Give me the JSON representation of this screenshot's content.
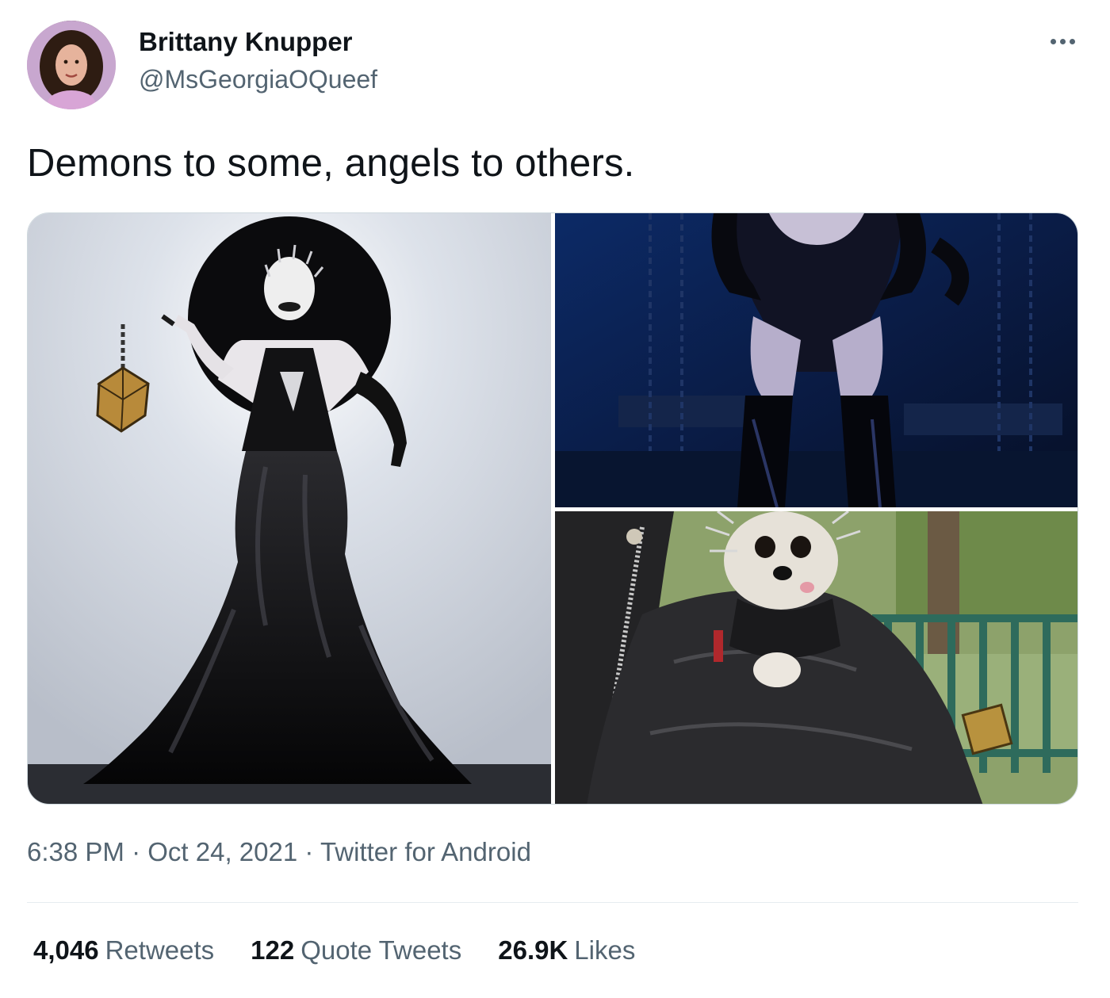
{
  "author": {
    "display_name": "Brittany Knupper",
    "handle": "@MsGeorgiaOQueef"
  },
  "tweet": {
    "text": "Demons to some, angels to others."
  },
  "meta": {
    "time": "6:38 PM",
    "separator": "·",
    "date": "Oct 24, 2021",
    "source": "Twitter for Android"
  },
  "stats": {
    "retweets_count": "4,046",
    "retweets_label": "Retweets",
    "quote_count": "122",
    "quote_label": "Quote Tweets",
    "likes_count": "26.9K",
    "likes_label": "Likes"
  },
  "icons": {
    "more": "more-horizontal-icon"
  },
  "colors": {
    "text_primary": "#0f1419",
    "text_secondary": "#536471",
    "border": "#cfd9de"
  }
}
